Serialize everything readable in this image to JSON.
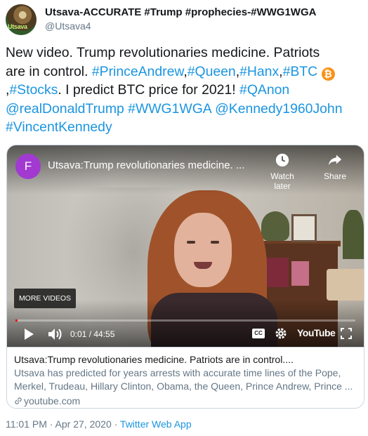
{
  "author": {
    "display_name": "Utsava-ACCURATE #Trump #prophecies-#WWG1WGA",
    "handle": "@Utsava4",
    "avatar_text": "Utsava"
  },
  "tweet": {
    "line1": "New video. Trump revolutionaries medicine. Patriots",
    "line2_text": "are in control. ",
    "line2_tags": [
      "#PrinceAndrew",
      "#Queen",
      "#Hanx",
      "#BTC"
    ],
    "line2_sep": ",",
    "btc_glyph": "₿",
    "line3_lead": ",",
    "line3_tag": "#Stocks",
    "line3_text": ". I predict BTC price for 2021! ",
    "line3_tag2": "#QAnon",
    "line4_tags": [
      "@realDonaldTrump",
      "#WWG1WGA",
      "@Kennedy1960John"
    ],
    "line5_tag": "#VincentKennedy"
  },
  "video": {
    "channel_initial": "F",
    "title": "Utsava:Trump revolutionaries medicine. ...",
    "watch_later_label": "Watch later",
    "share_label": "Share",
    "more_videos_label": "MORE VIDEOS",
    "time_display": "0:01 / 44:55",
    "progress": 0.0004,
    "cc_label": "CC",
    "logo_text": "YouTube"
  },
  "card": {
    "title": "Utsava:Trump revolutionaries medicine. Patriots are in control....",
    "desc_line1": "Utsava has predicted for years arrests with accurate time lines of the Pope,",
    "desc_line2": "Merkel, Trudeau, Hillary Clinton, Obama, the Queen, Prince Andrew, Prince ...",
    "domain": "youtube.com"
  },
  "meta": {
    "timestamp": "11:01 PM · Apr 27, 2020 · ",
    "source": "Twitter Web App"
  },
  "colors": {
    "link": "#1b95e0",
    "text": "#14171a",
    "secondary": "#657786",
    "btc": "#f7931a",
    "progress": "#ff0000",
    "channel_avatar": "#a239d1"
  },
  "icons": [
    "btc-icon",
    "clock-icon",
    "share-icon",
    "play-icon",
    "volume-icon",
    "settings-gear-icon",
    "fullscreen-icon",
    "link-icon"
  ]
}
